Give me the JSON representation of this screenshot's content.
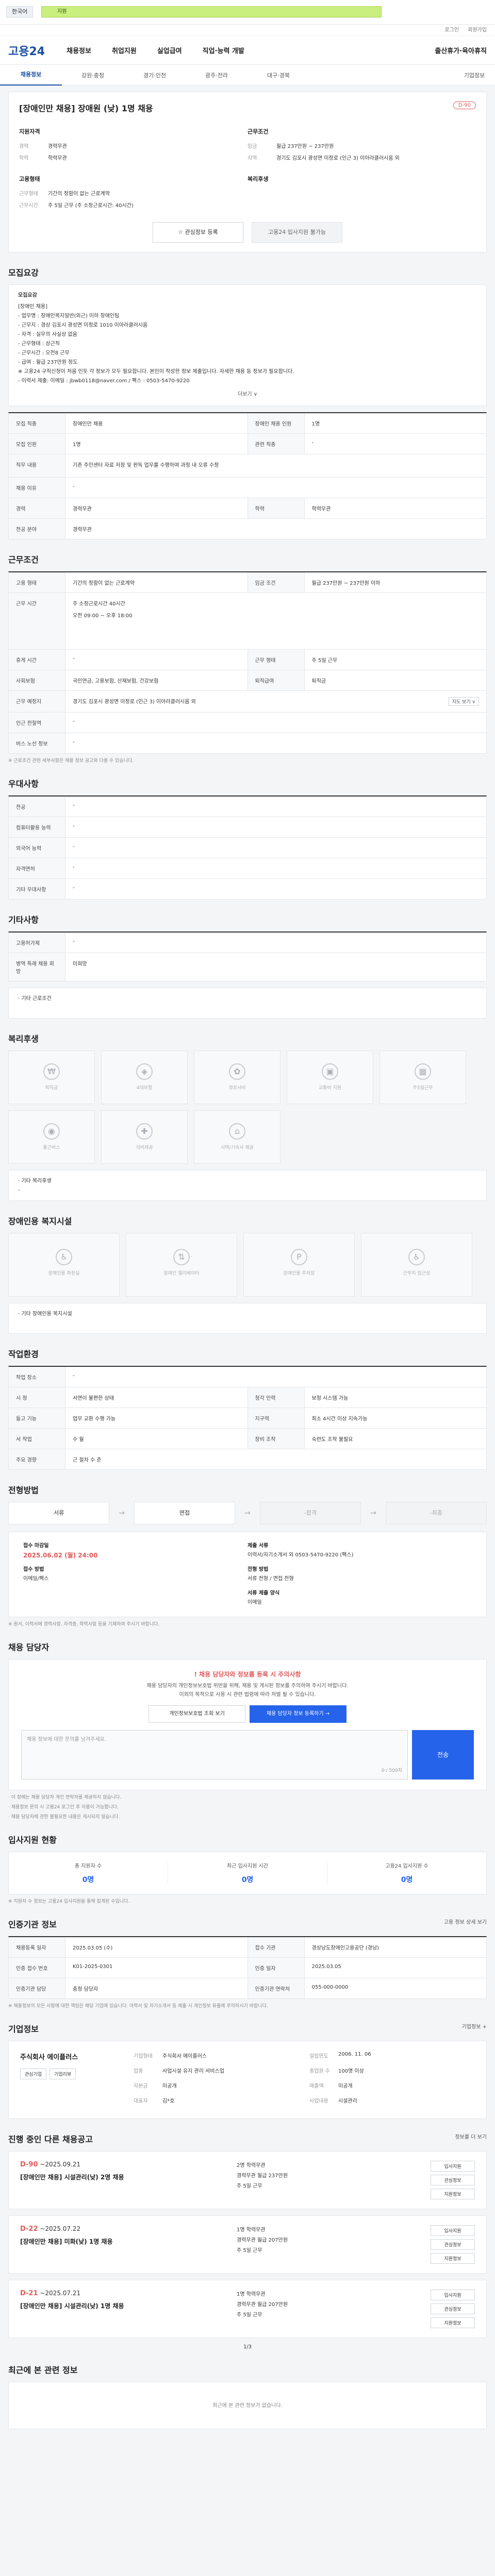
{
  "topbar": {
    "lang": "한국어",
    "green": "지원"
  },
  "util": [
    "로그인",
    "회원가입"
  ],
  "logo": "고용24",
  "nav": [
    "채용정보",
    "취업지원",
    "실업급여",
    "직업·능력 개발",
    "출산휴가·육아휴직"
  ],
  "tabs": [
    "채용정보",
    "강원·충청",
    "경기·인천",
    "광주·전라",
    "대구·경북",
    "기업정보"
  ],
  "hero": {
    "title": "[장애인만 채용] 장애원 (낮) 1명 채용",
    "badge": "D-90",
    "left_h": "지원자격",
    "left": [
      [
        "경력",
        "경력무관"
      ],
      [
        "학력",
        "학력무관"
      ]
    ],
    "right_h": "근무조건",
    "right": [
      [
        "임금",
        "월급 237만원 ~ 237만원"
      ],
      [
        "지역",
        "경기도 김포시 광성면 미정로 (인근 3) 이아라클러시움 외"
      ]
    ],
    "mid_left_h": "고용형태",
    "mid_left": [
      [
        "근무형태",
        "기간의 정함이 없는 근로계약"
      ],
      [
        "근무시간",
        "주 5일 근무 (주 소정근로시간: 40시간)"
      ]
    ],
    "mid_right_h": "복리후생",
    "save": "☆ 관심정보 등록",
    "apply": "고용24 입사지원 불가능"
  },
  "sec_recruit": {
    "title": "모집요강",
    "h": "모집요강"
  },
  "recruit_text": [
    "[장애인 채용]",
    "- 업무명 : 장애인복지일반(외근) 이하 장애인팀",
    "- 근무지 : 경상 김포시 광성면 미정로 1010 이아라클러시움",
    "- 자격 : 실무의 사실상 없음",
    "- 근무형태 : 상근직",
    "- 근무시간 : 오전8 근무",
    "- 급여 : 월급 237만원 정도",
    "※ 고용24 구직신청이 처음 인듯 각 정보가 모두 필요합니다. 본인이 작성한 정보 제출입니다. 자세한 채용 등 정보가 필요합니다.",
    "- 이력서 제출: 이메일 : jbwb0118@naver.com / 팩스 : 0503-5470-9220"
  ],
  "more": "더보기 ∨",
  "recruit_table": [
    [
      [
        "모집 직종",
        "장애인만 채용",
        "장애인 채용 인원",
        "1명"
      ]
    ],
    [
      [
        "모집 인원",
        "1명",
        "관련 직종",
        "-"
      ]
    ],
    [
      [
        "직무 내용",
        "기존 주민센터 자료 저장 및 판독 업무를 수행하여 과정 내 오류 수정"
      ]
    ],
    [
      [
        "채용 이유",
        "-"
      ]
    ],
    [
      [
        "경력",
        "경력무관",
        "학력",
        "학력무관"
      ]
    ],
    [
      [
        "전공 분야",
        "경력무관"
      ]
    ]
  ],
  "sec_conditions": "근무조건",
  "conditions": [
    [
      [
        "고용 형태",
        "기간의 정함이 없는 근로계약",
        "임금 조건",
        "월급 237만원 ~ 237만원 이하"
      ]
    ],
    [
      [
        "근무 시간",
        "주 소정근로시간 40시간",
        "",
        ""
      ]
    ],
    [
      [
        "",
        "오전 09:00 ~ 오후 18:00",
        "",
        ""
      ]
    ],
    [
      [
        "휴게 시간",
        "-",
        "근무 형태",
        "주 5일 근무"
      ]
    ],
    [
      [
        "사회보험",
        "국민연금, 고용보험, 산재보험, 건강보험",
        "퇴직급여",
        "퇴직금"
      ]
    ],
    [
      [
        "근무 예정지",
        "경기도 김포시 광성면 미정로 (인근 3) 이아라클러시움 외",
        "",
        ""
      ]
    ],
    [
      [
        "인근 전철역",
        "-",
        "",
        ""
      ]
    ],
    [
      [
        "버스 노선 정보",
        "-",
        "",
        ""
      ]
    ]
  ],
  "conditions_note": "※ 근로조건 관련 세부사항은 채용 정보 공고와 다를 수 있습니다.",
  "map_btn": "지도 보기 ∨",
  "sec_pref": "우대사항",
  "pref": [
    [
      "전공",
      "-"
    ],
    [
      "컴퓨터활용 능력",
      "-"
    ],
    [
      "외국어 능력",
      "-"
    ],
    [
      "자격면허",
      "-"
    ],
    [
      "기타 우대사항",
      "-"
    ]
  ],
  "sec_etc": "기타사항",
  "etc": [
    [
      "고용허가제",
      "-"
    ],
    [
      "병역 특례 채용 희망",
      "미희망"
    ]
  ],
  "etc_note": "· 기타 근로조건",
  "sec_welfare": "복리후생",
  "welfare": [
    "퇴직금",
    "4대보험",
    "경조사비",
    "교통비 지원",
    "주5일근무",
    "통근버스",
    "식비제공",
    "사택/기숙사 제공"
  ],
  "welfare_more": "· 기타 복리후생",
  "welfare_more_v": "-",
  "sec_disab": "장애인용 복지시설",
  "disab": [
    "장애인용 화장실",
    "장애인 엘리베이터",
    "장애인용 주차장",
    "근무지 접근성"
  ],
  "disab_more": "· 기타 장애인용 복지시설",
  "sec_work": "작업환경",
  "work": [
    [
      [
        "작업 장소",
        "-"
      ]
    ],
    [
      [
        "시 청",
        "서면이 불편한 상태",
        "청각 인력",
        "보청 시스템 가능"
      ]
    ],
    [
      [
        "들고 기능",
        "업무 교환 수행 가능",
        "지구력",
        "최소 4시간 이상 지속가능"
      ]
    ],
    [
      [
        "서 작업",
        "수 월",
        "장비 조작",
        "숙련도 조작 불필요"
      ]
    ],
    [
      [
        "주요 경향",
        "근 절차 수 준",
        "",
        ""
      ]
    ]
  ],
  "sec_process": "전형방법",
  "process": [
    "서류",
    "면접",
    "-합격",
    "-최종"
  ],
  "process_info": [
    [
      "접수 마감일",
      "2025.06.02 (월) 24:00"
    ],
    [
      "접수 방법",
      "이메일/팩스"
    ],
    [
      "제출 서류",
      "이력서/자기소개서 외 0503-5470-9220 (팩스)"
    ],
    [
      "전형 방법",
      "서류 전형 / 면접 전형"
    ],
    [
      "서류 제출 양식",
      "이메일"
    ]
  ],
  "process_note": "※ 원서, 이력서에 경력사항, 자격증, 학력사항 등을 기재하여 주시기 바랍니다.",
  "sec_contact": "채용 담당자",
  "inquiry": {
    "h": "! 채용 담당자와 정보를 등록 시 주의사항",
    "p1": "채용 담당자의 개인정보보호법 위반을 위해, 채용 및 게시된 정보를 주의하여 주시기 바랍니다.",
    "p2": "이외의 목적으로 사용 시 관련 법령에 따라 처벌 될 수 있습니다.",
    "b1": "개인정보보호법 조회 보기",
    "b2": "채용 담당자 정보 등록하기 →",
    "ta": "채용 정보에 대한 문의를 남겨주세요.",
    "cnt": "0 / 500자",
    "send": "전송"
  },
  "inquiry_notes": [
    "· 이 창에는 채용 담당자 개인 연락처를 제공하지 않습니다.",
    "· 채용정보 문의 시 고용24 로그인 후 이용이 가능합니다.",
    "· 채용 담당자에 관한 불필요한 내용은 게시되지 않습니다."
  ],
  "sec_stats": "입사지원 현황",
  "stats": [
    [
      "총 지원자 수",
      "0명"
    ],
    [
      "최근 입사지원 시간",
      "0명"
    ],
    [
      "고용24 입사지원 수",
      "0명"
    ]
  ],
  "stats_note": "※ 지원자 수 정보는 고용24 입사지원을 통해 집계된 수입니다.",
  "sec_agency": "인증기관 정보",
  "agency_more": "고용 정보 상세 보기",
  "agency": [
    [
      "채용등록 일자",
      "2025.03.05 (수)",
      "접수 기관",
      "경상남도장애인고용공단 (경남)"
    ],
    [
      "인증 접수 번호",
      "K01-2025-0301",
      "인증 일자",
      "2025.03.05"
    ],
    [
      "인증기관 담당",
      "충청 담당자",
      "인증기관 연락처",
      "055-000-0000"
    ]
  ],
  "agency_note": "※ 채용정보의 모든 사항에 대한 책임은 해당 기업에 있습니다. 이력서 및 자기소개서 등 제출 시 개인정보 유출에 주의하시기 바랍니다.",
  "sec_company": "기업정보",
  "company_more": "기업정보 +",
  "company": {
    "name": "주식회사 에이플러스",
    "b1": "관심기업",
    "b2": "기업리뷰"
  },
  "company_info": [
    [
      "기업형태",
      "주식회사 에이플러스"
    ],
    [
      "설립연도",
      "2006. 11. 06"
    ],
    [
      "업종",
      "사업시설 유지 관리 서비스업"
    ],
    [
      "종업원 수",
      "100명 이상"
    ],
    [
      "자본금",
      "미공개"
    ],
    [
      "매출액",
      "미공개"
    ],
    [
      "대표자",
      "김*호"
    ],
    [
      "사업내용",
      "시설관리"
    ]
  ],
  "sec_others": "진행 중인 다른 채용공고",
  "others_more": "정보를 더 보기",
  "others": [
    {
      "dday": "D-90",
      "date": "~2025.09.21",
      "title": "[장애인만 채용] 시설관리(낮) 2명 채용",
      "m1": "2명  학력무관",
      "m2": "경력무관  월급 237만원",
      "m3": "주 5일 근무"
    },
    {
      "dday": "D-22",
      "date": "~2025.07.22",
      "title": "[장애인만 채용] 미화(낮) 1명 채용",
      "m1": "1명  학력무관",
      "m2": "경력무관  월급 207만원",
      "m3": "주 5일 근무"
    },
    {
      "dday": "D-21",
      "date": "~2025.07.21",
      "title": "[장애인만 채용] 시설관리(낮) 1명 채용",
      "m1": "1명  학력무관",
      "m2": "경력무관  월급 207만원",
      "m3": "주 5일 근무"
    }
  ],
  "other_btns": [
    "입사지원",
    "관심정보",
    "지원정보"
  ],
  "pager": "1/3",
  "sec_recent": "최근에 본 관련 정보",
  "recent_empty": "최근에 본 관련 정보가 없습니다."
}
